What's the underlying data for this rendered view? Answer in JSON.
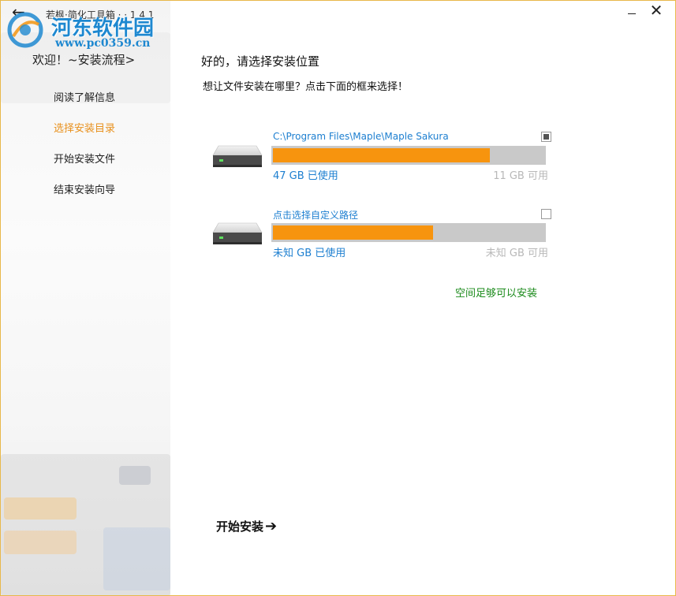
{
  "app": {
    "title": "若枫·简化工具箱 · · 1.4.1",
    "back_glyph": "←",
    "minimize_label": "",
    "close_glyph": "✕"
  },
  "watermark": {
    "name": "河东软件园",
    "url": "www.pc0359.cn"
  },
  "sidebar": {
    "welcome": "欢迎！~安装流程>",
    "steps": [
      {
        "label": "阅读了解信息",
        "active": false
      },
      {
        "label": "选择安装目录",
        "active": true
      },
      {
        "label": "开始安装文件",
        "active": false
      },
      {
        "label": "结束安装向导",
        "active": false
      }
    ]
  },
  "main": {
    "title": "好的，请选择安装位置",
    "subtitle": "想让文件安装在哪里？点击下面的框来选择！",
    "drives": [
      {
        "path": "C:\\Program Files\\Maple\\Maple Sakura",
        "used_label": "47  GB  已使用",
        "free_label": "11 GB  可用",
        "checked": true,
        "fill_fraction": 0.8
      },
      {
        "path": "点击选择自定义路径",
        "used_label": "未知  GB  已使用",
        "free_label": "未知  GB  可用",
        "checked": false,
        "fill_fraction": 0.59
      }
    ],
    "status": "空间足够可以安装",
    "start_label": "开始安装",
    "start_arrow": "➔"
  },
  "colors": {
    "accent_orange": "#f7940e",
    "active_step": "#e8901c",
    "link_blue": "#1d7fd0",
    "ok_green": "#1a8a1a",
    "border_gold": "#e8b84a"
  }
}
